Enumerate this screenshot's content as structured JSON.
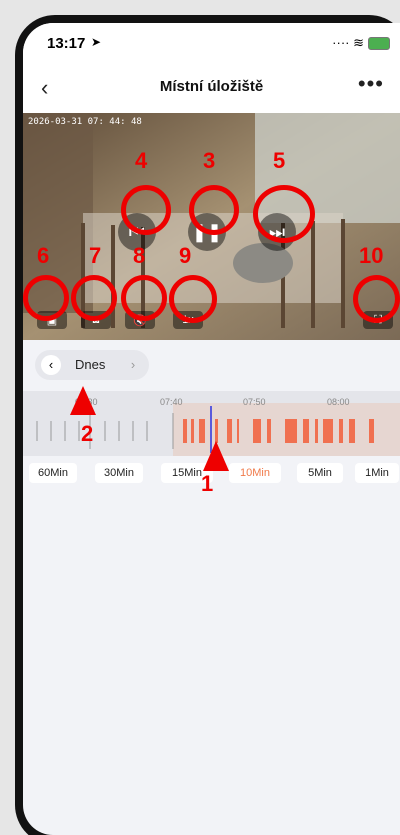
{
  "status": {
    "time": "13:17",
    "location_icon": "location-arrow-icon"
  },
  "nav": {
    "back": "‹",
    "title": "Místní úložiště",
    "more": "•••"
  },
  "video": {
    "timestamp": "2026-03-31  07: 44: 48",
    "speed": "1x"
  },
  "date": {
    "label": "Dnes"
  },
  "timeline": {
    "ticks": [
      "07:30",
      "07:40",
      "07:50",
      "08:00"
    ]
  },
  "zoom": [
    "60Min",
    "30Min",
    "15Min",
    "10Min",
    "5Min",
    "1Min"
  ],
  "zoom_active": "10Min",
  "annotations": [
    "1",
    "2",
    "3",
    "4",
    "5",
    "6",
    "7",
    "8",
    "9",
    "10"
  ]
}
